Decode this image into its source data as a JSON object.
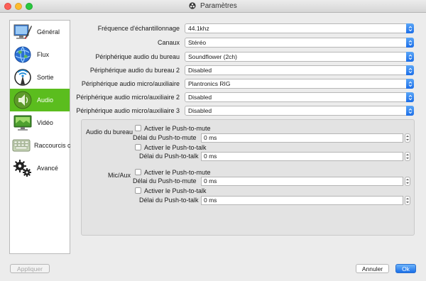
{
  "window": {
    "title": "Paramètres"
  },
  "sidebar": {
    "items": [
      {
        "label": "Général",
        "icon": "general-icon"
      },
      {
        "label": "Flux",
        "icon": "stream-icon"
      },
      {
        "label": "Sortie",
        "icon": "output-icon"
      },
      {
        "label": "Audio",
        "icon": "audio-icon",
        "active": true
      },
      {
        "label": "Vidéo",
        "icon": "video-icon"
      },
      {
        "label": "Raccourcis c",
        "icon": "hotkeys-icon"
      },
      {
        "label": "Avancé",
        "icon": "advanced-icon"
      }
    ]
  },
  "form": {
    "rows": [
      {
        "label": "Fréquence d'échantillonnage",
        "value": "44.1khz"
      },
      {
        "label": "Canaux",
        "value": "Stéréo"
      },
      {
        "label": "Périphérique audio du bureau",
        "value": "Soundflower (2ch)"
      },
      {
        "label": "Périphérique audio du bureau 2",
        "value": "Disabled"
      },
      {
        "label": "Périphérique audio micro/auxiliaire",
        "value": "Plantronics RIG"
      },
      {
        "label": "Périphérique audio micro/auxiliaire 2",
        "value": "Disabled"
      },
      {
        "label": "Périphérique audio micro/auxiliaire 3",
        "value": "Disabled"
      }
    ]
  },
  "hotkeys": {
    "desktop": {
      "label": "Audio du bureau",
      "ptm_check": "Activer le Push-to-mute",
      "ptm_delay_label": "Délai du Push-to-mute",
      "ptm_delay": "0 ms",
      "ptt_check": "Activer le Push-to-talk",
      "ptt_delay_label": "Délai du Push-to-talk",
      "ptt_delay": "0 ms"
    },
    "mic": {
      "label": "Mic/Aux",
      "ptm_check": "Activer le Push-to-mute",
      "ptm_delay_label": "Délai du Push-to-mute",
      "ptm_delay": "0 ms",
      "ptt_check": "Activer le Push-to-talk",
      "ptt_delay_label": "Délai du Push-to-talk",
      "ptt_delay": "0 ms"
    }
  },
  "buttons": {
    "apply": "Appliquer",
    "cancel": "Annuler",
    "ok": "Ok"
  },
  "colors": {
    "active_item": "#5bbd1e",
    "primary": "#1a6fe7",
    "dropdown_arrow": "#2f7ef0"
  }
}
